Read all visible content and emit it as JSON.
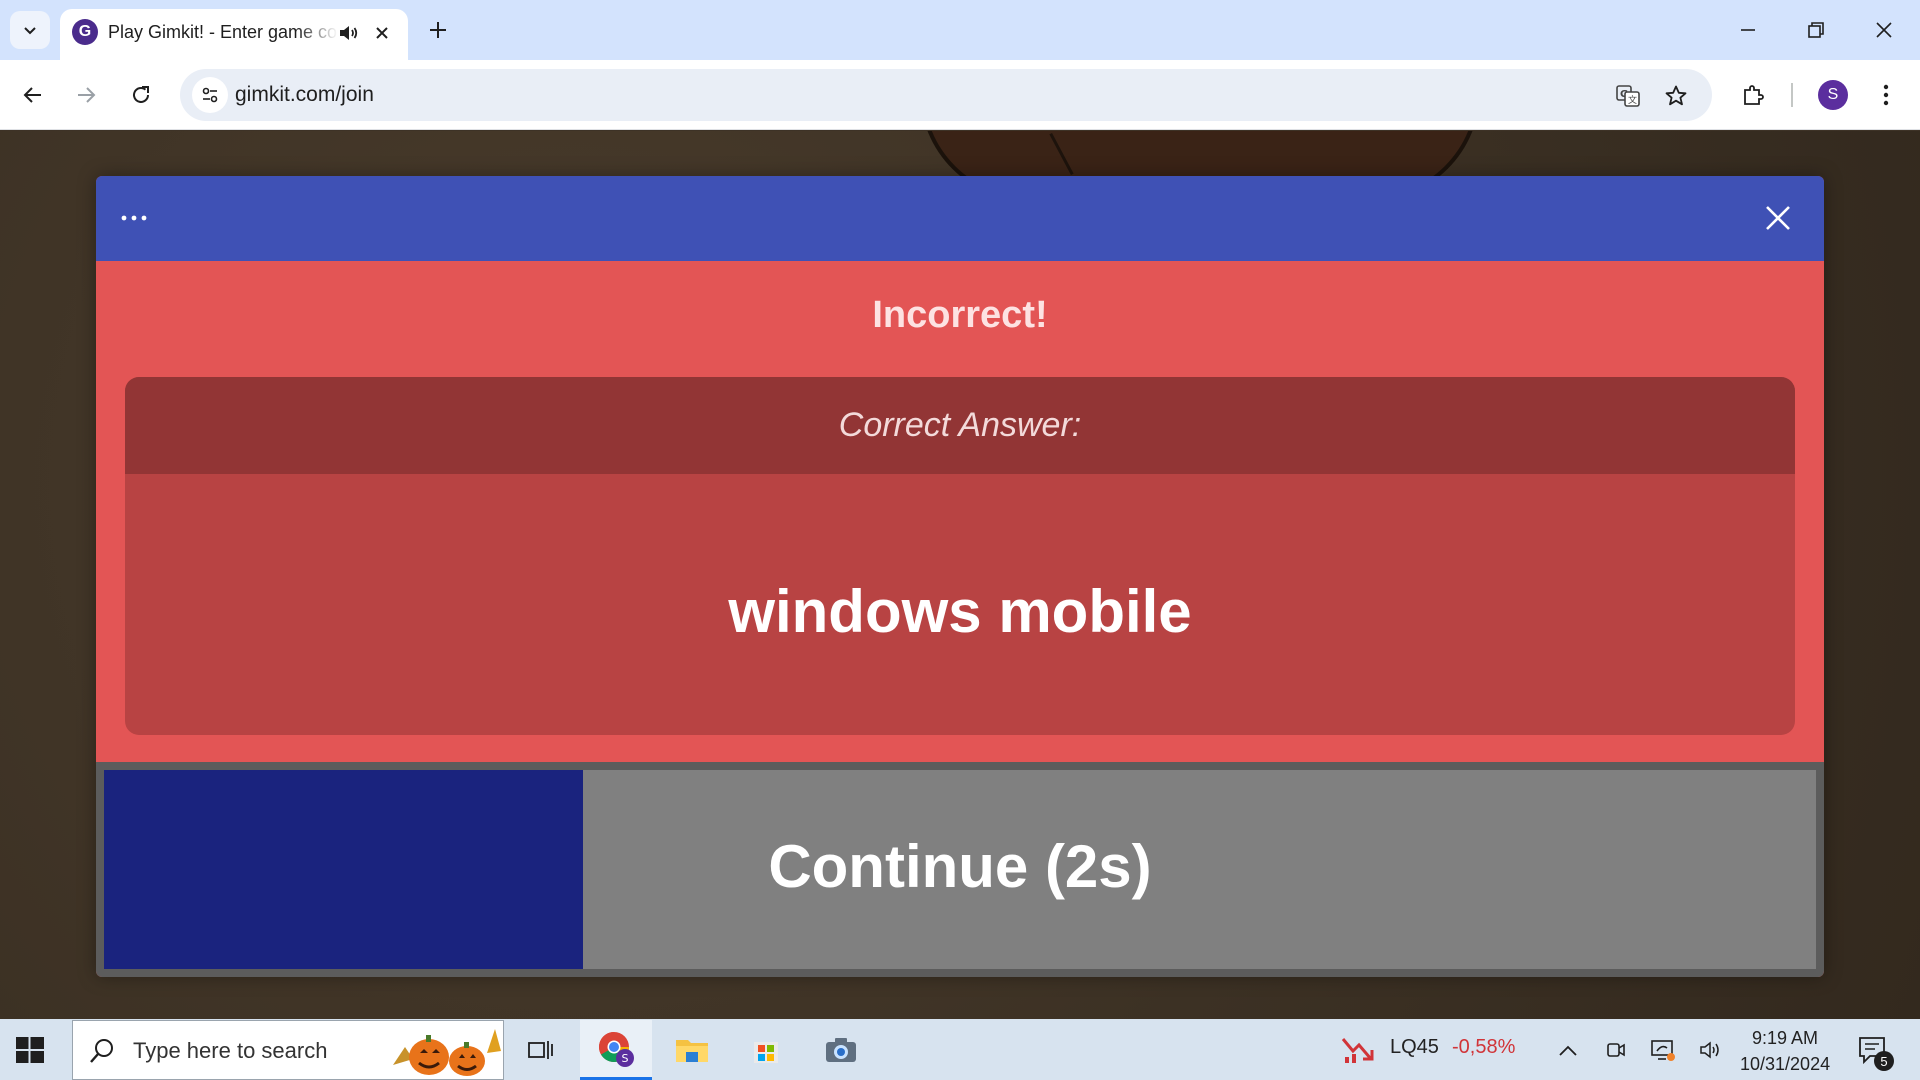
{
  "browser": {
    "tab": {
      "title": "Play Gimkit! - Enter game code",
      "favicon_letter": "G"
    },
    "url": "gimkit.com/join",
    "profile_initial": "S"
  },
  "modal": {
    "title": "Incorrect!",
    "answer_label": "Correct Answer:",
    "answer": "windows mobile",
    "continue_label": "Continue (2s)",
    "continue_progress": 0.28
  },
  "taskbar": {
    "search_placeholder": "Type here to search",
    "stock": {
      "name": "LQ45",
      "change": "-0,58%"
    },
    "clock": {
      "time": "9:19 AM",
      "date": "10/31/2024"
    },
    "notification_count": "5"
  },
  "colors": {
    "modal_header": "#3f51b5",
    "incorrect_red": "#e35555",
    "progress_blue": "#1a237e",
    "continue_gray": "#808080"
  },
  "icons": [
    "tab-search-icon",
    "gimkit-favicon",
    "speaker-icon",
    "close-icon",
    "plus-icon",
    "minimize-icon",
    "restore-icon",
    "back-arrow-icon",
    "forward-arrow-icon",
    "reload-icon",
    "site-info-icon",
    "translate-icon",
    "star-icon",
    "extensions-icon",
    "more-vert-icon",
    "ellipsis-icon",
    "windows-logo-icon",
    "search-icon",
    "task-view-icon",
    "chrome-icon",
    "file-explorer-icon",
    "store-icon",
    "camera-icon",
    "stock-down-icon",
    "chevron-up-icon",
    "meet-icon",
    "network-icon",
    "volume-icon",
    "notification-icon"
  ]
}
